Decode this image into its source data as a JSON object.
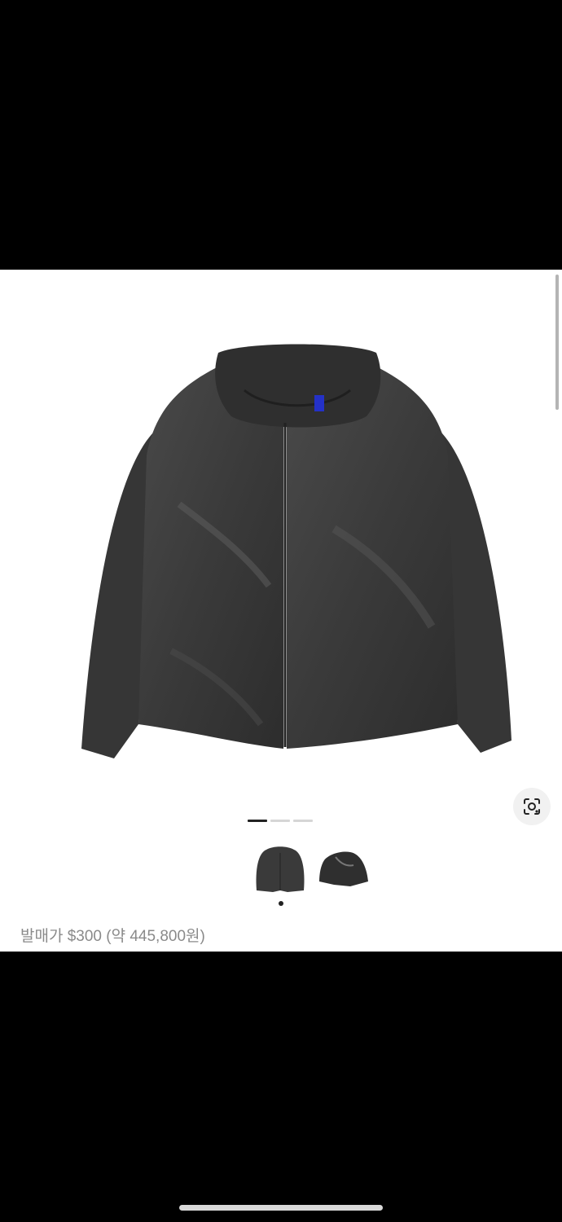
{
  "product": {
    "price_text": "발매가 $300 (약 445,800원)"
  },
  "gallery": {
    "slides": 3,
    "active_slide": 1,
    "thumbnails": [
      "front-view",
      "angled-view"
    ],
    "active_thumbnail": 1
  },
  "icons": {
    "lens": "visual-search-icon"
  },
  "colors": {
    "jacket": "#3b3b3b",
    "label": "#2431c7",
    "muted_text": "#8a8a8a"
  }
}
